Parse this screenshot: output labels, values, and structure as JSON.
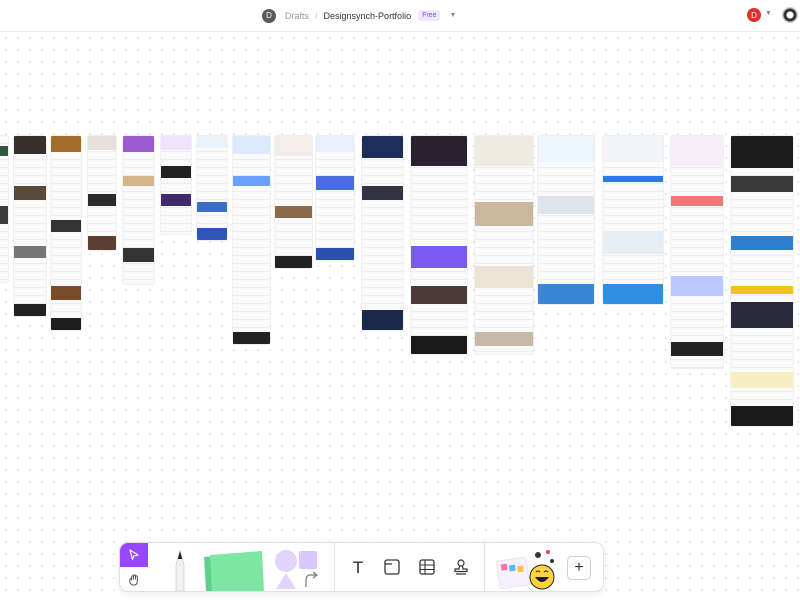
{
  "header": {
    "avatar_initial": "D",
    "breadcrumb_root": "Drafts",
    "separator": "/",
    "file_name": "Designsynch-Portfolio",
    "plan_badge": "Free",
    "user_initial": "D"
  },
  "icons": {
    "file-avatar": "user-circle",
    "file-menu": "chevron-down-icon",
    "user-menu": "chevron-down-icon",
    "main-menu": "camera-aperture-icon"
  },
  "toolbar": {
    "tools": [
      {
        "id": "move",
        "icon": "cursor-arrow-icon",
        "active": true
      },
      {
        "id": "hand",
        "icon": "hand-icon"
      },
      {
        "id": "pen",
        "icon": "pen-icon"
      },
      {
        "id": "sticky",
        "icon": "sticky-note-icon"
      },
      {
        "id": "shapes",
        "icon": "shapes-icon"
      },
      {
        "id": "text",
        "label": "T",
        "icon": "text-icon"
      },
      {
        "id": "section",
        "icon": "section-frame-icon"
      },
      {
        "id": "table",
        "icon": "table-icon"
      },
      {
        "id": "stamp",
        "icon": "stamp-icon"
      },
      {
        "id": "stickers",
        "icon": "stickers-emoji-icon"
      },
      {
        "id": "more",
        "label": "+",
        "icon": "plus-icon"
      }
    ]
  },
  "colors": {
    "accent": "#9747ff",
    "badge_text": "#7b4ce6",
    "user_avatar": "#e0312b",
    "sticky_note": "#7ee6a3",
    "shape_purple": "#d9c8ff"
  }
}
